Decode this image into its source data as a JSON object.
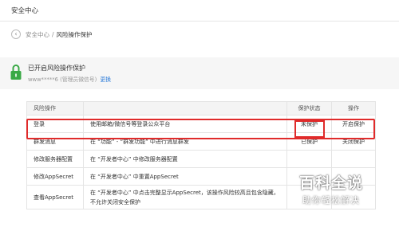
{
  "window": {
    "title": "安全中心"
  },
  "breadcrumb": {
    "parent": "安全中心",
    "separator": "/",
    "current": "风险操作保护"
  },
  "status": {
    "title": "已开启风险操作保护",
    "account": "www*****6",
    "role_note": "(管理员微信号)",
    "change_label": "更换",
    "lock_color": "#3aa946"
  },
  "table": {
    "headers": {
      "operation": "风险操作",
      "description": "",
      "state": "保护状态",
      "action": "操作"
    },
    "rows": [
      {
        "name": "登录",
        "desc": "使用邮箱/微信号等登录公众平台",
        "state": "未保护",
        "action": "开启保护"
      },
      {
        "name": "群发消息",
        "desc": "在 “功能” - “群发功能” 中进行消息群发",
        "state": "已保护",
        "action": "关闭保护"
      },
      {
        "name": "修改服务器配置",
        "desc": "在 “开发者中心” 中修改服务器配置",
        "state": "",
        "action": ""
      },
      {
        "name": "修改AppSecret",
        "desc": "在 “开发者中心” 中重置AppSecret",
        "state": "",
        "action": ""
      },
      {
        "name": "查看AppSecret",
        "desc": "在 “开发者中心” 中点击完整显示AppSecret，该操作风险较高且包含隐藏，不允许关闭安全保护",
        "state": "",
        "action": ""
      }
    ]
  },
  "highlight_color": "#e02b2b",
  "watermark": {
    "main": "百科全说",
    "sub": "助你轻松解决"
  }
}
